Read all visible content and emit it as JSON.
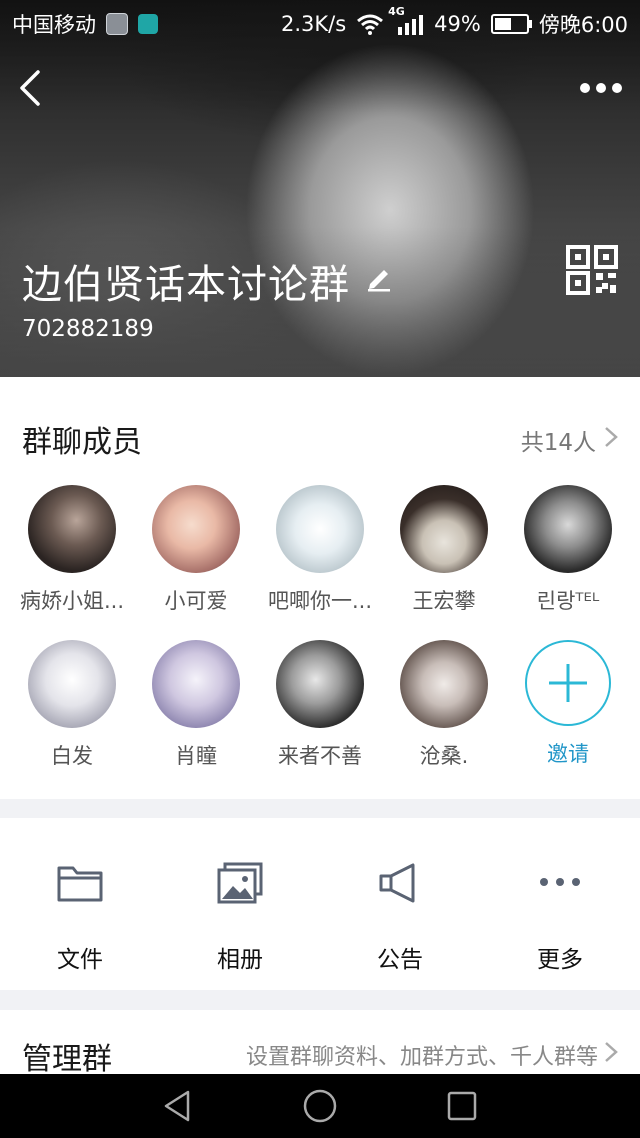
{
  "status_bar": {
    "carrier": "中国移动",
    "speed": "2.3K/s",
    "network": "4G",
    "battery": "49%",
    "battery_fraction": 0.49,
    "time": "傍晚6:00"
  },
  "group": {
    "name": "边伯贤话本讨论群",
    "id": "702882189"
  },
  "members": {
    "title": "群聊成员",
    "count_label": "共14人",
    "list": [
      {
        "name": "病娇小姐..."
      },
      {
        "name": "小可爱"
      },
      {
        "name": "吧唧你一..."
      },
      {
        "name": "王宏攀"
      },
      {
        "name": "린랑ᵀᴱᴸ"
      },
      {
        "name": "白发"
      },
      {
        "name": "肖瞳"
      },
      {
        "name": "来者不善"
      },
      {
        "name": "沧桑."
      }
    ],
    "invite_label": "邀请"
  },
  "features": [
    {
      "label": "文件",
      "icon": "folder-icon"
    },
    {
      "label": "相册",
      "icon": "album-icon"
    },
    {
      "label": "公告",
      "icon": "megaphone-icon"
    },
    {
      "label": "更多",
      "icon": "more-dots-icon"
    }
  ],
  "manage": {
    "title": "管理群",
    "description": "设置群聊资料、加群方式、千人群等"
  },
  "colors": {
    "accent": "#2bb8d6",
    "invite_text": "#2196c8",
    "background": "#f1f2f5"
  }
}
